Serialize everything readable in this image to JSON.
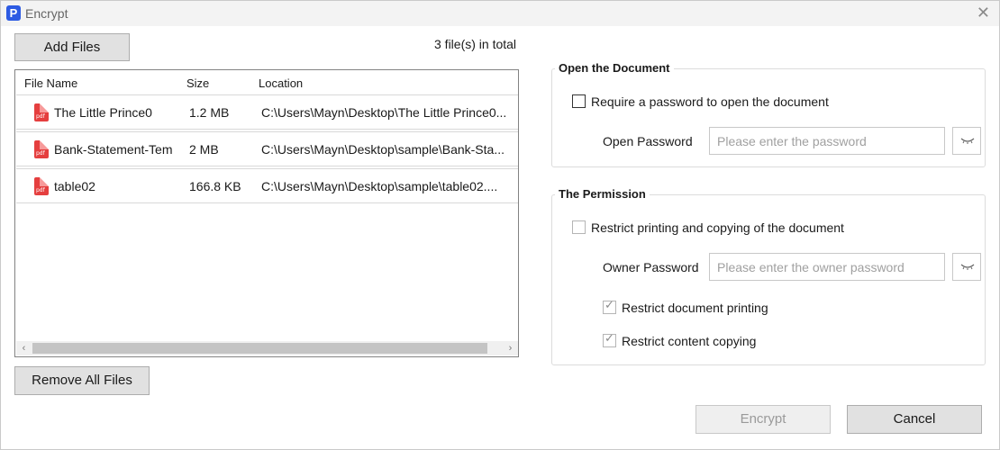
{
  "window": {
    "title": "Encrypt",
    "app_icon_letter": "P"
  },
  "toolbar": {
    "add_files_label": "Add Files",
    "total_label": "3 file(s) in total",
    "remove_all_label": "Remove All Files"
  },
  "file_list": {
    "columns": [
      "File Name",
      "Size",
      "Location"
    ],
    "rows": [
      {
        "name": "The Little Prince0",
        "size": "1.2 MB",
        "location": "C:\\Users\\Mayn\\Desktop\\The Little Prince0..."
      },
      {
        "name": "Bank-Statement-Tem",
        "size": "2 MB",
        "location": "C:\\Users\\Mayn\\Desktop\\sample\\Bank-Sta..."
      },
      {
        "name": "table02",
        "size": "166.8 KB",
        "location": "C:\\Users\\Mayn\\Desktop\\sample\\table02...."
      }
    ]
  },
  "open_document": {
    "title": "Open the Document",
    "require_password_label": "Require a password to open the document",
    "require_password_checked": false,
    "open_password_label": "Open Password",
    "open_password_placeholder": "Please enter the password"
  },
  "permission": {
    "title": "The Permission",
    "restrict_label": "Restrict printing and copying of the document",
    "restrict_checked": false,
    "owner_password_label": "Owner Password",
    "owner_password_placeholder": "Please enter the owner password",
    "restrict_printing_label": "Restrict document printing",
    "restrict_printing_checked": true,
    "restrict_copying_label": "Restrict content copying",
    "restrict_copying_checked": true
  },
  "footer": {
    "encrypt_label": "Encrypt",
    "cancel_label": "Cancel"
  },
  "colors": {
    "accent": "#2d5be3",
    "pdf_red": "#e53f3f"
  },
  "icons": [
    "app-logo-icon",
    "close-icon",
    "pdf-file-icon",
    "eye-closed-icon",
    "scroll-left-icon",
    "scroll-right-icon"
  ]
}
